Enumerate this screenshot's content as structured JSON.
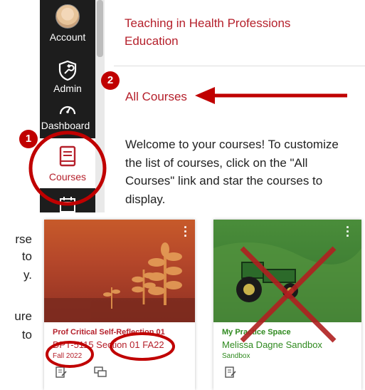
{
  "nav": {
    "account_label": "Account",
    "admin_label": "Admin",
    "dashboard_label": "Dashboard",
    "courses_label": "Courses"
  },
  "panel": {
    "course_title": "Teaching in Health Professions Education",
    "all_courses_link": "All Courses",
    "welcome_text": "Welcome to your courses! To customize the list of courses, click on the \"All Courses\" link and star the courses to display."
  },
  "badges": {
    "one": "1",
    "two": "2"
  },
  "left_text": {
    "line1": "rse",
    "line2": "to",
    "line3": "y.",
    "line4": "ure",
    "line5": "to"
  },
  "cards": [
    {
      "name": "Prof Critical Self-Reflection 01",
      "subtitle": "DPT-5115 Section 01 FA22",
      "term": "Fall 2022",
      "color": "#b5202b"
    },
    {
      "name": "My Practice Space",
      "subtitle": "Melissa Dagne Sandbox",
      "term": "Sandbox",
      "color": "#2f8a1f"
    }
  ],
  "colors": {
    "accent": "#b5202b",
    "annotation": "#c00000",
    "nav_bg": "#1d1d1d"
  }
}
